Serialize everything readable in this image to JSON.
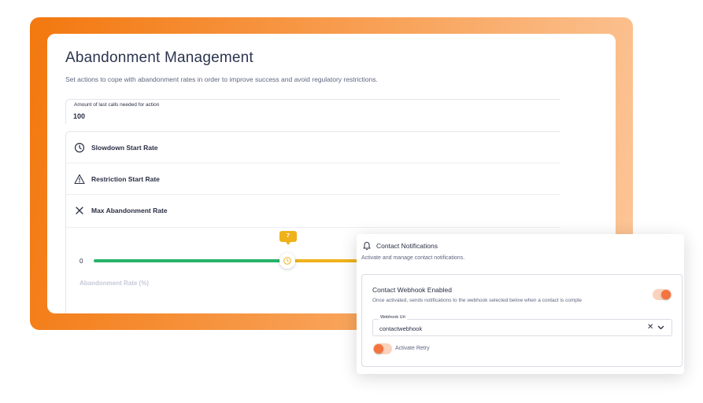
{
  "abandonment": {
    "title": "Abandonment Management",
    "subtitle": "Set actions to cope with abandonment rates in order to improve success and avoid regulatory restrictions.",
    "last_calls_field": {
      "label": "Amount of last calls needed for action",
      "value": "100"
    },
    "rates": [
      {
        "label": "Slowdown Start Rate",
        "icon": "clock-icon"
      },
      {
        "label": "Restriction Start Rate",
        "icon": "warning-triangle-icon"
      },
      {
        "label": "Max Abandonment Rate",
        "icon": "close-x-icon"
      }
    ],
    "slider": {
      "min_label": "0",
      "current_value": "7",
      "axis_title": "Abandonment Rate (%)",
      "green_color": "#27b36a",
      "yellow_color": "#f0b21a"
    }
  },
  "contact_notifications": {
    "title": "Contact Notifications",
    "subtitle": "Activate and manage contact notifications.",
    "header_icon": "bell-icon",
    "webhook": {
      "title": "Contact Webhook Enabled",
      "description": "Once activated, sends notifications to the webhook selected below when a contact is comple",
      "enabled": true
    },
    "url_field": {
      "label": "Webhook Url",
      "value": "contactwebhook"
    },
    "retry": {
      "label": "Activate Retry",
      "enabled": false
    },
    "accent_color": "#f4733e"
  },
  "colors": {
    "frame_gradient_start": "#f3780f",
    "frame_gradient_end": "#fcc699"
  }
}
